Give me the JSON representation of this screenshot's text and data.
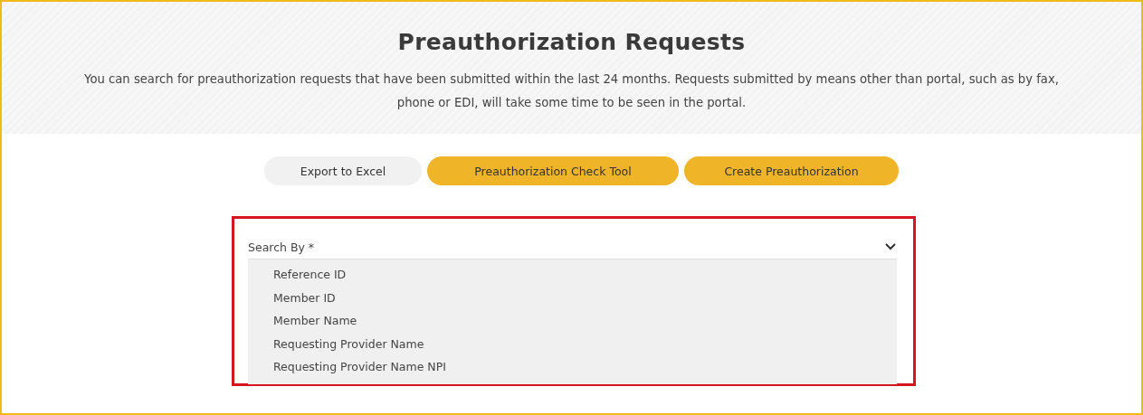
{
  "header": {
    "title": "Preauthorization Requests",
    "description": "You can search for preauthorization requests that have been submitted within the last 24 months. Requests submitted by means other than portal, such as by fax, phone or EDI, will take some time to be seen in the portal."
  },
  "actions": [
    {
      "label": "Export to Excel",
      "kind": "secondary"
    },
    {
      "label": "Preauthorization Check Tool",
      "kind": "primary"
    },
    {
      "label": "Create Preauthorization",
      "kind": "primary"
    }
  ],
  "search_by": {
    "label": "Search By *",
    "expanded": true,
    "options": [
      {
        "label": "Reference ID"
      },
      {
        "label": "Member ID"
      },
      {
        "label": "Member Name"
      },
      {
        "label": "Requesting Provider Name"
      },
      {
        "label": "Requesting Provider Name NPI"
      }
    ]
  }
}
